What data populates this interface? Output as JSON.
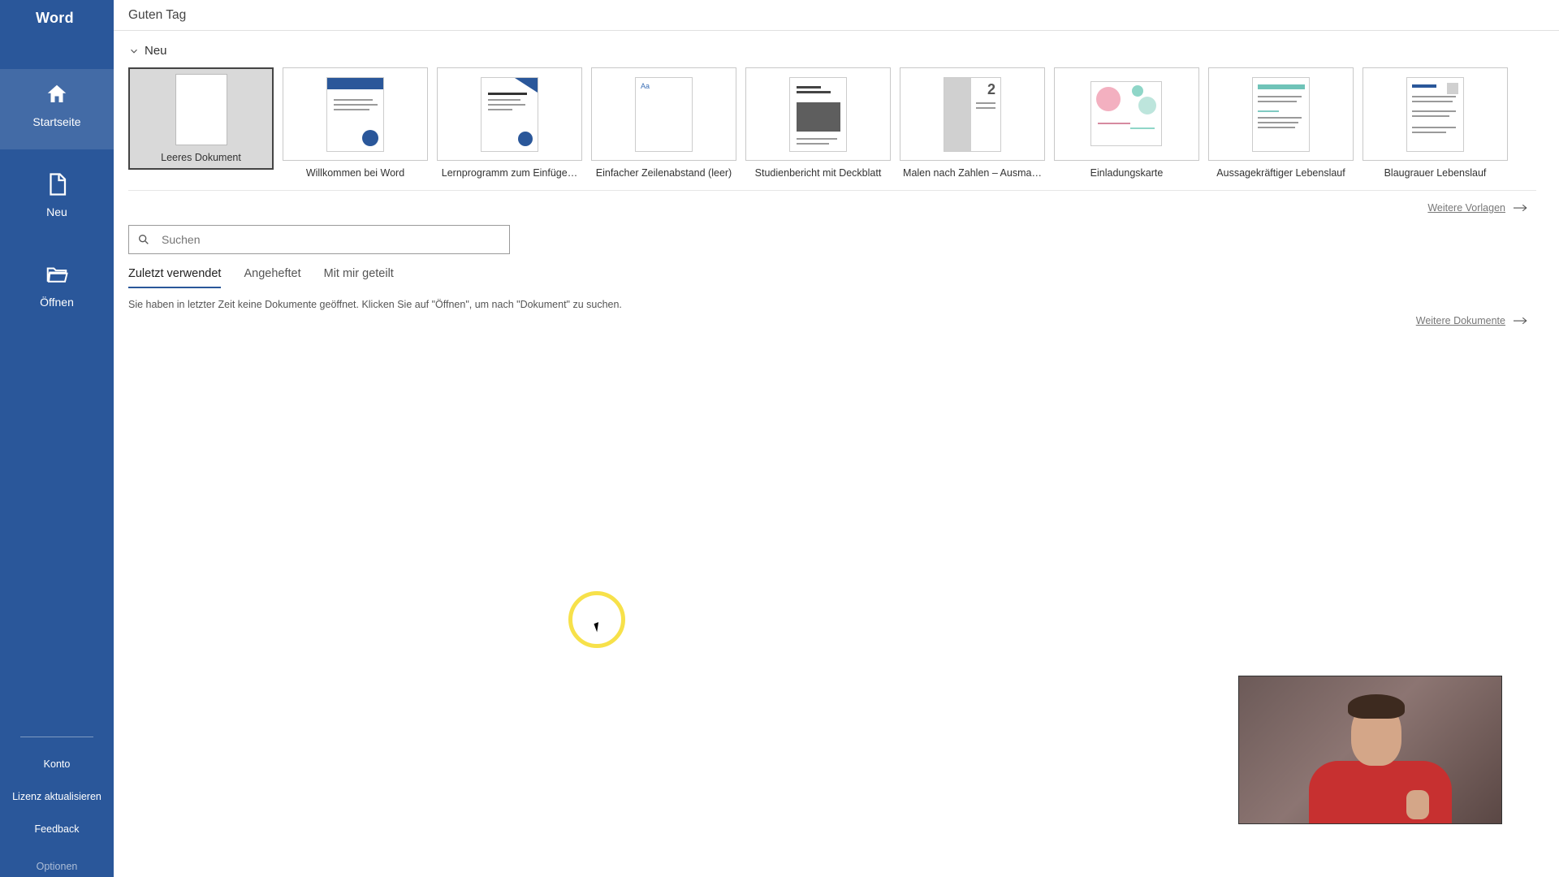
{
  "app_title": "Word",
  "greeting": "Guten Tag",
  "sidebar": {
    "items": [
      {
        "id": "home",
        "label": "Startseite",
        "active": true
      },
      {
        "id": "new",
        "label": "Neu",
        "active": false
      },
      {
        "id": "open",
        "label": "Öffnen",
        "active": false
      }
    ],
    "bottom": {
      "account": "Konto",
      "update": "Lizenz aktualisieren",
      "feedback": "Feedback",
      "options": "Optionen"
    }
  },
  "new_section": {
    "heading": "Neu",
    "templates": [
      {
        "label": "Leeres Dokument",
        "selected": true
      },
      {
        "label": "Willkommen bei Word"
      },
      {
        "label": "Lernprogramm zum Einfüge…"
      },
      {
        "label": "Einfacher Zeilenabstand (leer)"
      },
      {
        "label": "Studienbericht mit Deckblatt"
      },
      {
        "label": "Malen nach Zahlen – Ausma…"
      },
      {
        "label": "Einladungskarte"
      },
      {
        "label": "Aussagekräftiger Lebenslauf"
      },
      {
        "label": "Blaugrauer Lebenslauf"
      }
    ],
    "more_templates": "Weitere Vorlagen"
  },
  "search": {
    "placeholder": "Suchen"
  },
  "recent": {
    "tabs": [
      {
        "id": "recent",
        "label": "Zuletzt verwendet",
        "active": true
      },
      {
        "id": "pinned",
        "label": "Angeheftet",
        "active": false
      },
      {
        "id": "shared",
        "label": "Mit mir geteilt",
        "active": false
      }
    ],
    "empty_message": "Sie haben in letzter Zeit keine Dokumente geöffnet. Klicken Sie auf \"Öffnen\", um nach \"Dokument\" zu suchen.",
    "more_documents": "Weitere Dokumente"
  }
}
